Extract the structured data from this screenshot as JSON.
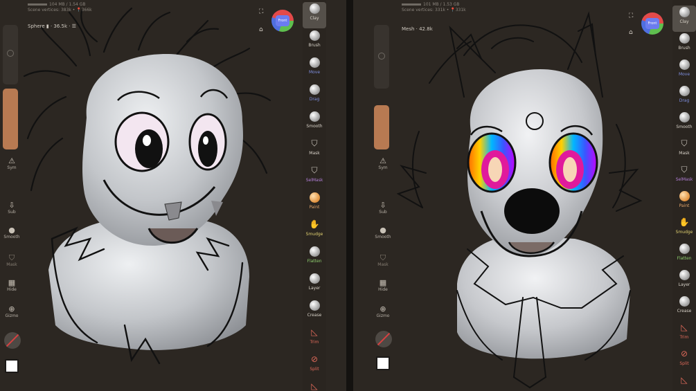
{
  "left": {
    "stats": {
      "line1": "104 MB / 1.54 GB",
      "line2": "Scene vertices: 383k • 📍366k"
    },
    "mesh_label": "Sphere ▮ · 36.5k · ☰",
    "gizmo_label": "Front",
    "left_items": {
      "sym": "Sym",
      "sub": "Sub",
      "smooth": "Smooth",
      "mask": "Mask",
      "hide": "Hide",
      "gizmo": "Gizmo"
    },
    "tools": [
      "Clay",
      "Brush",
      "Move",
      "Drag",
      "Smooth",
      "Mask",
      "SelMask",
      "Paint",
      "Smudge",
      "Flatten",
      "Layer",
      "Crease",
      "Trim",
      "Split"
    ]
  },
  "right": {
    "stats": {
      "line1": "101 MB / 1.53 GB",
      "line2": "Scene vertices: 331k • 📍331k"
    },
    "mesh_label": "Mesh · 42.8k",
    "gizmo_label": "Front",
    "left_items": {
      "sym": "Sym",
      "sub": "Sub",
      "smooth": "Smooth",
      "mask": "Mask",
      "hide": "Hide",
      "gizmo": "Gizmo"
    },
    "tools": [
      "Clay",
      "Brush",
      "Move",
      "Drag",
      "Smooth",
      "Mask",
      "SelMask",
      "Paint",
      "Smudge",
      "Flatten",
      "Layer",
      "Crease",
      "Trim",
      "Split"
    ]
  },
  "colors": {
    "bg": "#2c2722",
    "clay": "#c5c7ca",
    "accent_orange": "#b87a52"
  }
}
